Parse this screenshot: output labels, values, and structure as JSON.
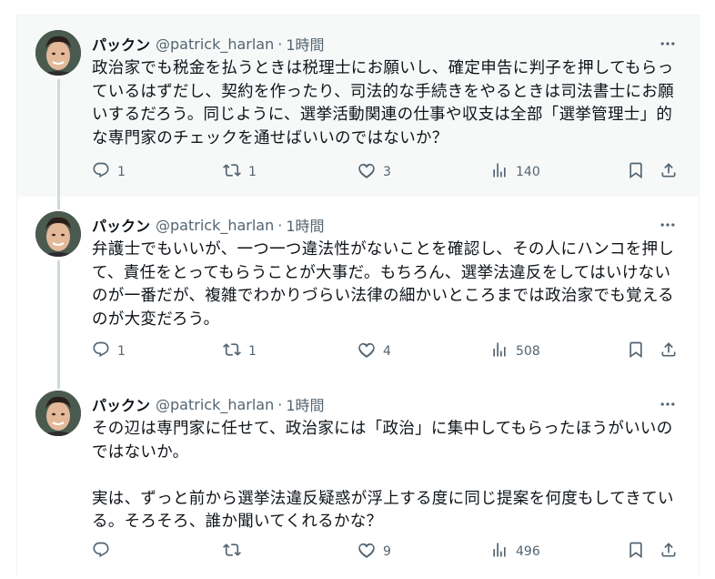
{
  "tweets": [
    {
      "name": "パックン",
      "handle": "@patrick_harlan",
      "dot": "·",
      "time": "1時間",
      "text": "政治家でも税金を払うときは税理士にお願いし、確定申告に判子を押してもらっているはずだし、契約を作ったり、司法的な手続きをやるときは司法書士にお願いするだろう。同じように、選挙活動関連の仕事や収支は全部「選挙管理士」的な専門家のチェックを通せばいいのではないか？",
      "replies": "1",
      "retweets": "1",
      "likes": "3",
      "views": "140"
    },
    {
      "name": "パックン",
      "handle": "@patrick_harlan",
      "dot": "·",
      "time": "1時間",
      "text": "弁護士でもいいが、一つ一つ違法性がないことを確認し、その人にハンコを押して、責任をとってもらうことが大事だ。もちろん、選挙法違反をしてはいけないのが一番だが、複雑でわかりづらい法律の細かいところまでは政治家でも覚えるのが大変だろう。",
      "replies": "1",
      "retweets": "1",
      "likes": "4",
      "views": "508"
    },
    {
      "name": "パックン",
      "handle": "@patrick_harlan",
      "dot": "·",
      "time": "1時間",
      "text": "その辺は専門家に任せて、政治家には「政治」に集中してもらったほうがいいのではないか。\n\n実は、ずっと前から選挙法違反疑惑が浮上する度に同じ提案を何度もしてきている。そろそろ、誰か聞いてくれるかな？",
      "replies": "",
      "retweets": "",
      "likes": "9",
      "views": "496"
    }
  ],
  "icons": {
    "more": "more-icon",
    "reply": "reply-icon",
    "retweet": "retweet-icon",
    "like": "heart-icon",
    "views": "views-icon",
    "bookmark": "bookmark-icon",
    "share": "share-icon"
  }
}
